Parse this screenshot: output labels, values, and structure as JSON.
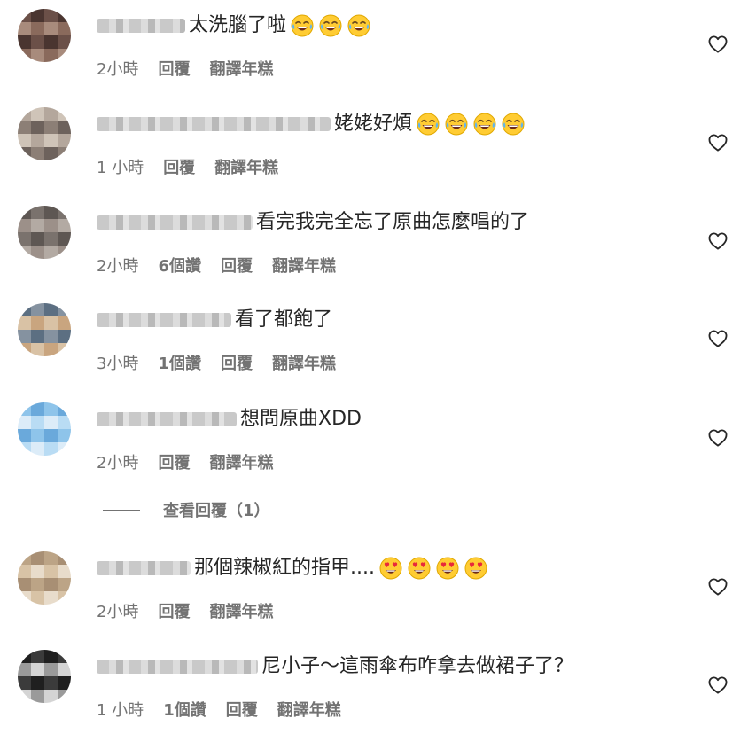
{
  "comments": [
    {
      "text": "太洗腦了啦",
      "emojis": [
        "joy",
        "joy",
        "joy"
      ],
      "time": "2小時",
      "likes": "",
      "reply": "回覆",
      "translate": "翻譯年糕",
      "avatar_palette": [
        "#6b5048",
        "#8a6a5c",
        "#4a3530",
        "#a88b7c"
      ]
    },
    {
      "text": "姥姥好煩",
      "emojis": [
        "joy",
        "joy",
        "joy",
        "joy"
      ],
      "time": "1 小時",
      "likes": "",
      "reply": "回覆",
      "translate": "翻譯年糕",
      "avatar_palette": [
        "#8c7f76",
        "#b4a79c",
        "#6d625c",
        "#cfc4b8"
      ]
    },
    {
      "text": "看完我完全忘了原曲怎麼唱的了",
      "emojis": [],
      "time": "2小時",
      "likes": "6個讚",
      "reply": "回覆",
      "translate": "翻譯年糕",
      "avatar_palette": [
        "#7a726d",
        "#9c9089",
        "#5e5753",
        "#b3aaa3"
      ]
    },
    {
      "text": "看了都飽了",
      "emojis": [],
      "time": "3小時",
      "likes": "1個讚",
      "reply": "回覆",
      "translate": "翻譯年糕",
      "avatar_palette": [
        "#c9a57f",
        "#8592a0",
        "#d9c2a5",
        "#5c6f82"
      ]
    },
    {
      "text": "想問原曲XDD",
      "emojis": [],
      "time": "2小時",
      "likes": "",
      "reply": "回覆",
      "translate": "翻譯年糕",
      "avatar_palette": [
        "#8ec4ea",
        "#b9dcf4",
        "#6aa9db",
        "#dcecf8"
      ]
    },
    {
      "text": "那個辣椒紅的指甲....",
      "emojis": [
        "heart-eyes",
        "heart-eyes",
        "heart-eyes",
        "heart-eyes"
      ],
      "time": "2小時",
      "likes": "",
      "reply": "回覆",
      "translate": "翻譯年糕",
      "avatar_palette": [
        "#d8c3a6",
        "#bca486",
        "#e8dccb",
        "#a88f74"
      ]
    },
    {
      "text": "尼小子～這雨傘布咋拿去做裙子了？",
      "emojis": [],
      "time": "1 小時",
      "likes": "1個讚",
      "reply": "回覆",
      "translate": "翻譯年糕",
      "avatar_palette": [
        "#3b3b3b",
        "#9a9a9a",
        "#1f1f1f",
        "#d4d4d4"
      ]
    }
  ],
  "view_replies": {
    "label": "查看回覆（1）"
  },
  "colors": {
    "text": "#262626",
    "secondary": "#737373"
  }
}
